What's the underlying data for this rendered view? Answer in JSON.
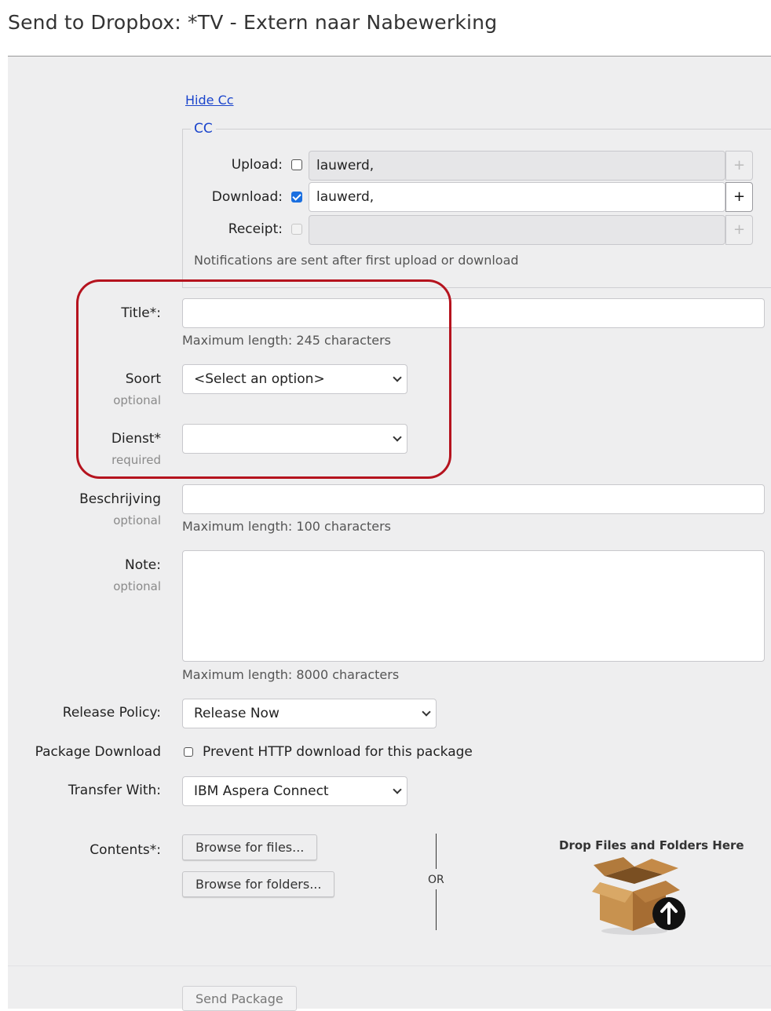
{
  "page": {
    "title": "Send to Dropbox: *TV - Extern naar Nabewerking"
  },
  "cc": {
    "toggle_link": "Hide Cc",
    "legend": "CC",
    "rows": [
      {
        "label": "Upload:",
        "checked": false,
        "enabled": true,
        "value": "lauwerd,",
        "add": "+"
      },
      {
        "label": "Download:",
        "checked": true,
        "enabled": true,
        "value": "lauwerd,",
        "add": "+"
      },
      {
        "label": "Receipt:",
        "checked": false,
        "enabled": false,
        "value": "",
        "add": "+"
      }
    ],
    "note": "Notifications are sent after first upload or download"
  },
  "fields": {
    "title": {
      "label": "Title*:",
      "value": "",
      "hint": "Maximum length: 245 characters"
    },
    "soort": {
      "label": "Soort",
      "sub": "optional",
      "selected": "<Select an option>"
    },
    "dienst": {
      "label": "Dienst*",
      "sub": "required",
      "selected": ""
    },
    "beschrijving": {
      "label": "Beschrijving",
      "sub": "optional",
      "value": "",
      "hint": "Maximum length: 100 characters"
    },
    "note": {
      "label": "Note:",
      "sub": "optional",
      "value": "",
      "hint": "Maximum length: 8000 characters"
    },
    "release_policy": {
      "label": "Release Policy:",
      "selected": "Release Now"
    },
    "package_download": {
      "label": "Package Download",
      "checkbox_label": "Prevent HTTP download for this package",
      "checked": false
    },
    "transfer_with": {
      "label": "Transfer With:",
      "selected": "IBM Aspera Connect"
    },
    "contents": {
      "label": "Contents*:",
      "browse_files": "Browse for files...",
      "browse_folders": "Browse for folders...",
      "or": "OR",
      "drop_title": "Drop Files and Folders Here"
    }
  },
  "footer": {
    "send_button": "Send Package"
  },
  "colors": {
    "link": "#1a44cc",
    "highlight": "#b5131e",
    "checkbox_checked": "#1a6fe0",
    "form_bg": "#eeeeef"
  },
  "icons": {
    "drop_zone": "cardboard-box-upload-icon",
    "select_arrow": "chevron-down-icon"
  }
}
